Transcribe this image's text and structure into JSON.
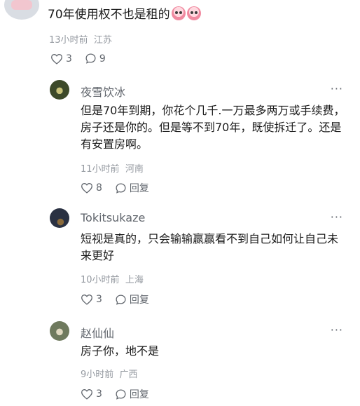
{
  "top_comment": {
    "text": "70年使用权不也是租的",
    "time": "13小时前",
    "location": "江苏",
    "likes": "3",
    "replies": "9"
  },
  "replies": [
    {
      "name": "夜雪饮冰",
      "body": "但是70年到期，你花个几千.一万最多两万或手续费，房子还是你的。但是等不到70年，既使拆迁了。还是有安置房啊。",
      "time": "11小时前",
      "location": "河南",
      "likes": "8",
      "reply_label": "回复"
    },
    {
      "name": "Tokitsukaze",
      "body": "短视是真的，只会输输赢赢看不到自己如何让自己未来更好",
      "time": "10小时前",
      "location": "上海",
      "likes": "3",
      "reply_label": "回复"
    },
    {
      "name": "赵仙仙",
      "body": "房子你，地不是",
      "time": "9小时前",
      "location": "广西",
      "likes": "3",
      "reply_label": "回复"
    }
  ],
  "icons": {
    "like": "heart-icon",
    "comment": "comment-bubble-icon",
    "more": "more-dots-icon",
    "emoji": "crying-face-emoji-icon"
  }
}
